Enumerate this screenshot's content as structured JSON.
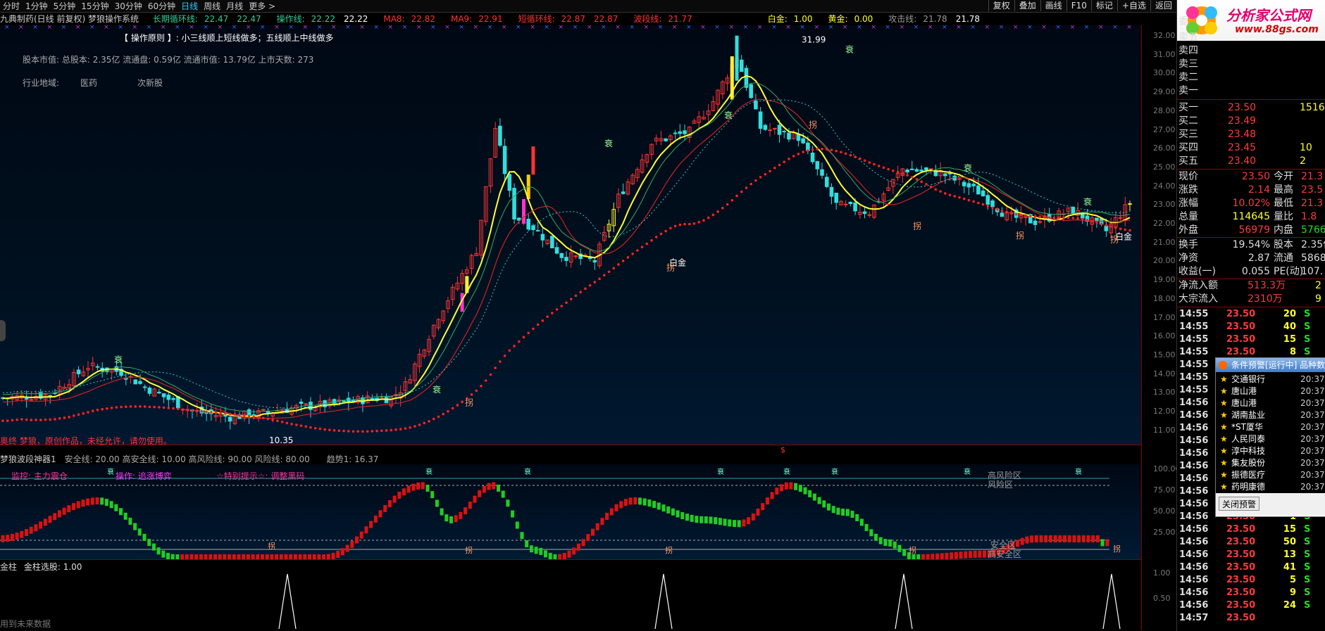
{
  "topbar": {
    "periods": [
      "分时",
      "1分钟",
      "5分钟",
      "15分钟",
      "30分钟",
      "60分钟",
      "日线",
      "周线",
      "月线",
      "更多 >"
    ],
    "active_index": 6,
    "right_buttons": [
      "复权",
      "叠加",
      "画线",
      "F10",
      "标记",
      "+自选",
      "返回"
    ]
  },
  "main": {
    "title": "九典制药(日线 前复权) 梦狼操作系统",
    "indicators": [
      {
        "label": "长期循环线:",
        "value": "22.47",
        "value2": "22.47",
        "color": "#33cc99"
      },
      {
        "label": "操作线:",
        "value": "22.22",
        "value2": "22.22",
        "color": "#33cc99"
      },
      {
        "label": "MA8:",
        "value": "22.82",
        "color": "#ff3333"
      },
      {
        "label": "MA9:",
        "value": "22.91",
        "color": "#ff3333"
      },
      {
        "label": "短循环线:",
        "value": "22.87",
        "value2": "22.87",
        "color": "#ff3333"
      },
      {
        "label": "波段线:",
        "value": "21.77",
        "color": "#ff3333"
      },
      {
        "label": "白金:",
        "value": "1.00",
        "color": "#ffff33"
      },
      {
        "label": "黄金:",
        "value": "0.00",
        "color": "#ffff33"
      },
      {
        "label": "攻击线:",
        "value": "21.78",
        "value2": "21.78",
        "color": "#999999"
      }
    ],
    "principle": "【 操作原则 】: 小三线顺上短线做多；五线顺上中线做多",
    "capital": "股本市值: 总股本: 2.35亿 流通盘: 0.59亿 流通市值: 13.79亿 上市天数: 273",
    "industry_label": "行业地域:",
    "industry_1": "医药",
    "industry_2": "次新股",
    "copyright": "奥终 梦狼，原创作品，未经允许，请勿使用。",
    "annotations": {
      "high": "31.99",
      "low": "10.35",
      "baijin_1": "白金",
      "baijin_2": "白金",
      "guai": "拐",
      "shuai": "衰"
    },
    "y_ticks": [
      "32.00",
      "31.00",
      "30.00",
      "29.00",
      "28.00",
      "27.00",
      "26.00",
      "25.00",
      "24.00",
      "23.00",
      "22.00",
      "21.00",
      "20.00",
      "19.00",
      "18.00",
      "17.00",
      "16.00",
      "15.00",
      "14.00",
      "13.00",
      "12.00",
      "11.00"
    ]
  },
  "sub1": {
    "title": "梦狼波段神器1",
    "params": "安全线: 20.00 高安全线: 10.00 高风险线: 90.00 风险线: 80.00",
    "trend": "趋势1: 16.37",
    "monitor": "监控: 主力震仓",
    "operate": "操作: 追涨博弈",
    "special": "☆特别提示☆: 调整黑码",
    "zone_high_risk": "高风险区",
    "zone_risk": "风险区",
    "zone_safe": "安全区",
    "zone_high_safe": "高安全区",
    "y_ticks": [
      "100.00",
      "75.00",
      "50.00",
      "25.00"
    ]
  },
  "sub2": {
    "title": "金柱",
    "value": "金柱选股: 1.00",
    "footer": "用到未来数据",
    "y_ticks": [
      "1.00",
      "0.50"
    ]
  },
  "quote": {
    "sell": [
      "卖五",
      "卖四",
      "卖三",
      "卖二",
      "卖一"
    ],
    "sell_top": "委",
    "buy": [
      {
        "k": "买一",
        "v": "23.50",
        "n": "1516"
      },
      {
        "k": "买二",
        "v": "23.49",
        "n": ""
      },
      {
        "k": "买三",
        "v": "23.48",
        "n": ""
      },
      {
        "k": "买四",
        "v": "23.45",
        "n": "10"
      },
      {
        "k": "买五",
        "v": "23.40",
        "n": "2"
      }
    ],
    "stats": [
      {
        "k": "现价",
        "v": "23.50",
        "k2": "今开",
        "v2": "21.3"
      },
      {
        "k": "涨跌",
        "v": "2.14",
        "k2": "最高",
        "v2": "23.5"
      },
      {
        "k": "涨幅",
        "v": "10.02%",
        "k2": "最低",
        "v2": "21.3"
      },
      {
        "k": "总量",
        "v": "114645",
        "k2": "量比",
        "v2": "1.8"
      },
      {
        "k": "外盘",
        "v": "56979",
        "k2": "内盘",
        "v2": "5766"
      }
    ],
    "stats2": [
      {
        "k": "换手",
        "v": "19.54%",
        "k2": "股本",
        "v2": "2.35亿"
      },
      {
        "k": "净资",
        "v": "2.87",
        "k2": "流通",
        "v2": "5868万"
      },
      {
        "k": "收益(一)",
        "v": "0.055",
        "k2": "PE(动)",
        "v2": "107."
      }
    ],
    "flows": [
      {
        "k": "净流入额",
        "v": "513.3万",
        "v2": "2"
      },
      {
        "k": "大宗流入",
        "v": "2310万",
        "v2": "9"
      }
    ]
  },
  "ticks": [
    {
      "t": "14:55",
      "p": "23.50",
      "v": "20",
      "s": "S"
    },
    {
      "t": "14:55",
      "p": "23.50",
      "v": "40",
      "s": "S"
    },
    {
      "t": "14:55",
      "p": "23.50",
      "v": "15",
      "s": "S"
    },
    {
      "t": "14:55",
      "p": "23.50",
      "v": "8",
      "s": "S"
    },
    {
      "t": "14:55",
      "p": "",
      "v": "",
      "s": ""
    },
    {
      "t": "14:55",
      "p": "",
      "v": "",
      "s": ""
    },
    {
      "t": "14:55",
      "p": "",
      "v": "",
      "s": ""
    },
    {
      "t": "14:56",
      "p": "",
      "v": "",
      "s": ""
    },
    {
      "t": "14:56",
      "p": "",
      "v": "",
      "s": ""
    },
    {
      "t": "14:56",
      "p": "",
      "v": "",
      "s": ""
    },
    {
      "t": "14:56",
      "p": "",
      "v": "",
      "s": ""
    },
    {
      "t": "14:56",
      "p": "",
      "v": "",
      "s": ""
    },
    {
      "t": "14:56",
      "p": "",
      "v": "",
      "s": ""
    },
    {
      "t": "14:56",
      "p": "",
      "v": "",
      "s": ""
    },
    {
      "t": "14:56",
      "p": "",
      "v": "",
      "s": ""
    },
    {
      "t": "14:56",
      "p": "",
      "v": "",
      "s": ""
    },
    {
      "t": "14:56",
      "p": "23.50",
      "v": "1",
      "s": "S"
    },
    {
      "t": "14:56",
      "p": "23.50",
      "v": "15",
      "s": "S"
    },
    {
      "t": "14:56",
      "p": "23.50",
      "v": "50",
      "s": "S"
    },
    {
      "t": "14:56",
      "p": "23.50",
      "v": "13",
      "s": "S"
    },
    {
      "t": "14:56",
      "p": "23.50",
      "v": "41",
      "s": "S"
    },
    {
      "t": "14:56",
      "p": "23.50",
      "v": "5",
      "s": "S"
    },
    {
      "t": "14:56",
      "p": "23.50",
      "v": "9",
      "s": "S"
    },
    {
      "t": "14:56",
      "p": "23.50",
      "v": "24",
      "s": "S"
    },
    {
      "t": "14:57",
      "p": "23.50",
      "v": "",
      "s": ""
    }
  ],
  "logo": {
    "title": "分析家公式网",
    "url": "www.88gs.com"
  },
  "popup": {
    "title": "条件预警[运行中] 品种数",
    "items": [
      {
        "name": "交通银行",
        "time": "20:37"
      },
      {
        "name": "唐山港",
        "time": "20:37"
      },
      {
        "name": "唐山港",
        "time": "20:37"
      },
      {
        "name": "湖南盐业",
        "time": "20:37"
      },
      {
        "name": "*ST厦华",
        "time": "20:37"
      },
      {
        "name": "人民同泰",
        "time": "20:37"
      },
      {
        "name": "淳中科技",
        "time": "20:37"
      },
      {
        "name": "集友股份",
        "time": "20:37"
      },
      {
        "name": "振德医疗",
        "time": "20:37"
      },
      {
        "name": "药明康德",
        "time": "20:37"
      }
    ],
    "close_label": "关闭预警"
  },
  "colors": {
    "up": "#ff3333",
    "down": "#33dddd",
    "yellow": "#ffee33",
    "green": "#22cc22"
  }
}
